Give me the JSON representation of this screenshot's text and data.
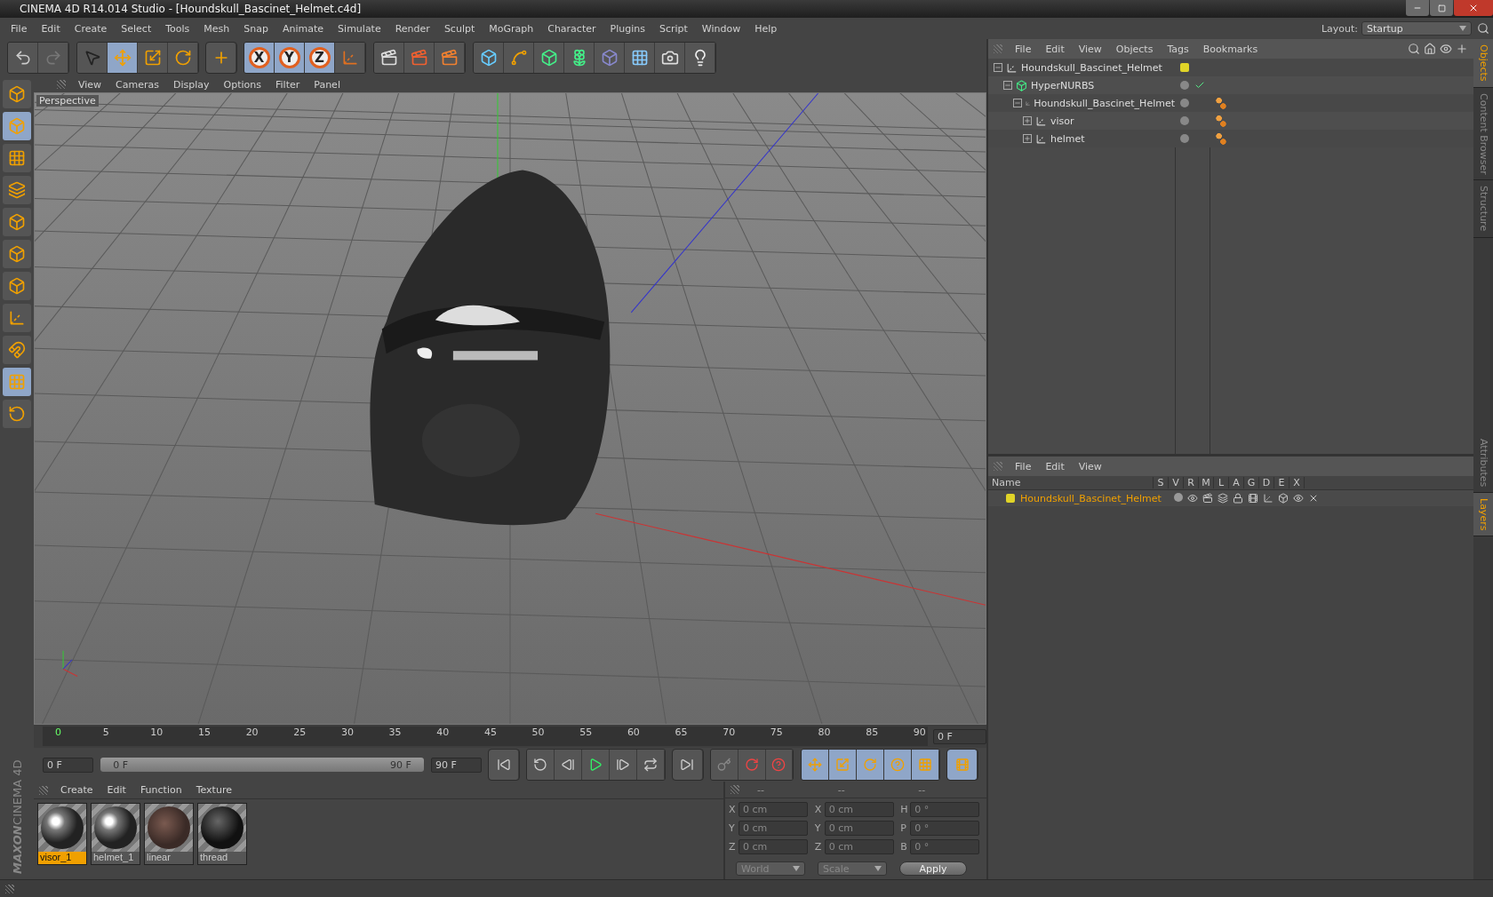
{
  "window": {
    "title": "CINEMA 4D R14.014 Studio - [Houndskull_Bascinet_Helmet.c4d]"
  },
  "menu": [
    "File",
    "Edit",
    "Create",
    "Select",
    "Tools",
    "Mesh",
    "Snap",
    "Animate",
    "Simulate",
    "Render",
    "Sculpt",
    "MoGraph",
    "Character",
    "Plugins",
    "Script",
    "Window",
    "Help"
  ],
  "layout": {
    "label": "Layout:",
    "value": "Startup"
  },
  "toolbar": {
    "tools": [
      {
        "selected": false
      },
      {
        "selected": false
      },
      {
        "selected": false
      },
      {
        "selected": true
      },
      {
        "selected": false
      },
      {
        "selected": false
      },
      {
        "selected": false
      }
    ],
    "axes": [
      {
        "label": "X",
        "selected": true
      },
      {
        "label": "Y",
        "selected": true
      },
      {
        "label": "Z",
        "selected": true
      }
    ]
  },
  "left_tools": [
    {
      "selected": false
    },
    {
      "selected": true
    },
    {
      "selected": false
    },
    {
      "selected": false
    },
    {
      "selected": false
    },
    {
      "selected": false
    },
    {
      "selected": false
    },
    {
      "selected": false
    },
    {
      "selected": false
    },
    {
      "selected": true
    },
    {
      "selected": false
    }
  ],
  "logo": {
    "brand": "MAXON",
    "product": "CINEMA 4D"
  },
  "viewport": {
    "menu": [
      "View",
      "Cameras",
      "Display",
      "Options",
      "Filter",
      "Panel"
    ],
    "label": "Perspective"
  },
  "objects": {
    "menu": [
      "File",
      "Edit",
      "View",
      "Objects",
      "Tags",
      "Bookmarks"
    ],
    "tree": [
      {
        "name": "Houndskull_Bascinet_Helmet",
        "kind": "null",
        "expanded": true,
        "color": "#e0d428",
        "children": [
          {
            "name": "HyperNURBS",
            "kind": "nurbs",
            "expanded": true,
            "enabled": true,
            "children": [
              {
                "name": "Houndskull_Bascinet_Helmet",
                "kind": "null",
                "expanded": true,
                "children": [
                  {
                    "name": "visor",
                    "kind": "null",
                    "expanded": false
                  },
                  {
                    "name": "helmet",
                    "kind": "null",
                    "expanded": false
                  }
                ]
              }
            ]
          }
        ]
      }
    ]
  },
  "layers": {
    "menu": [
      "File",
      "Edit",
      "View"
    ],
    "columns": [
      "Name",
      "S",
      "V",
      "R",
      "M",
      "L",
      "A",
      "G",
      "D",
      "E",
      "X"
    ],
    "rows": [
      {
        "name": "Houndskull_Bascinet_Helmet",
        "color": "#e0d428"
      }
    ]
  },
  "side_tabs": [
    {
      "label": "Objects",
      "selected": true
    },
    {
      "label": "Content Browser",
      "selected": false
    },
    {
      "label": "Structure",
      "selected": false
    }
  ],
  "side_tabs_lower": [
    {
      "label": "Attributes",
      "selected": false
    },
    {
      "label": "Layers",
      "selected": true
    }
  ],
  "timeline": {
    "ticks": [
      "0",
      "5",
      "10",
      "15",
      "20",
      "25",
      "30",
      "35",
      "40",
      "45",
      "50",
      "55",
      "60",
      "65",
      "70",
      "75",
      "80",
      "85",
      "90"
    ],
    "current": "0 F",
    "start": "0 F",
    "range": {
      "start": "0 F",
      "end": "90 F",
      "level": 1
    },
    "end": "90 F"
  },
  "materials": {
    "menu": [
      "Create",
      "Edit",
      "Function",
      "Texture"
    ],
    "items": [
      {
        "name": "visor_1",
        "kind": "chrome",
        "selected": true
      },
      {
        "name": "helmet_1",
        "kind": "chrome",
        "selected": false
      },
      {
        "name": "linear",
        "kind": "brown",
        "selected": false
      },
      {
        "name": "thread",
        "kind": "black",
        "selected": false
      }
    ]
  },
  "coordinates": {
    "headers": [
      "--",
      "--",
      "--"
    ],
    "rows": [
      [
        {
          "axis": "X",
          "value": "0 cm"
        },
        {
          "axis": "X",
          "value": "0 cm"
        },
        {
          "axis": "H",
          "value": "0 °"
        }
      ],
      [
        {
          "axis": "Y",
          "value": "0 cm"
        },
        {
          "axis": "Y",
          "value": "0 cm"
        },
        {
          "axis": "P",
          "value": "0 °"
        }
      ],
      [
        {
          "axis": "Z",
          "value": "0 cm"
        },
        {
          "axis": "Z",
          "value": "0 cm"
        },
        {
          "axis": "B",
          "value": "0 °"
        }
      ]
    ],
    "space": "World",
    "mode": "Scale",
    "apply": "Apply"
  }
}
